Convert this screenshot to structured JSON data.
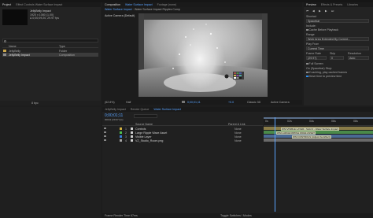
{
  "project": {
    "tabs": [
      "Project",
      "Effect Controls Water Surface Impact"
    ],
    "thumb_name": "JellyBelly Impact",
    "thumb_info": [
      "1920 x 1080 (1.00)",
      "Δ 0;00;09;20, 29.97 fps"
    ],
    "search_placeholder": "",
    "columns": [
      "Name",
      "Type"
    ],
    "items": [
      {
        "name": "JellyBelly",
        "type": "Folder",
        "color": "#e0c84e"
      },
      {
        "name": "JellyBelly Impact",
        "type": "Composition",
        "color": "#a6a6a6"
      }
    ],
    "footer": "8 bpc"
  },
  "composition": {
    "tabs": [
      "Composition",
      "Water Surface Impact",
      "Footage (none)"
    ],
    "sub_tabs": [
      "Water Surface Impact",
      "Water Surface Impact Ripples Comp"
    ],
    "camera_label": "Active Camera (Default)",
    "footer": {
      "zoom": "(62.8%)",
      "resolution": "Half",
      "timecode": "0;00;01;11",
      "exposure": "+0.0",
      "renderer": "Classic 3D",
      "view": "Active Camera",
      "views": "1 View"
    }
  },
  "preview": {
    "tabs": [
      "Preview",
      "Effects & Presets",
      "Libraries"
    ],
    "shortcut_label": "Shortcut",
    "shortcut_value": "Spacebar",
    "include_label": "Include:",
    "cache_label": "Cache Before Playback",
    "range_label": "Range",
    "range_value": "Work Area Extended By Current...",
    "play_from_label": "Play From",
    "play_from_value": "Current Time",
    "frame_rate_label": "Frame Rate",
    "skip_label": "Skip",
    "resolution_label": "Resolution",
    "frame_rate_value": "(29.97)",
    "skip_value": "0",
    "resolution_value": "Auto",
    "full_screen_label": "Full Screen",
    "on_stop_label": "On (Spacebar) Stop:",
    "if_caching_label": "If caching, play cached frames",
    "move_time_label": "Move time to preview time"
  },
  "timeline": {
    "tabs": [
      "JellyBelly Impact",
      "Render Queue",
      "Water Surface Impact"
    ],
    "timecode": "0;00;01;11",
    "fps_info": "00041 (29.97 fps)",
    "search_placeholder": "",
    "col_source": "Source Name",
    "col_parent": "Parent & Link",
    "layers": [
      {
        "num": "1",
        "name": "Controls",
        "parent": "None",
        "color": "#d4b342"
      },
      {
        "num": "2",
        "name": "Large Ripple Wave Asset",
        "parent": "None",
        "color": "#4ec24e"
      },
      {
        "num": "3",
        "name": "Visible Layer",
        "parent": "None",
        "color": "#3a7fd8"
      },
      {
        "num": "4",
        "name": "VZ_Studio_Room.png",
        "parent": "None",
        "color": "#a6a6a6"
      }
    ],
    "ruler_marks": [
      "0s",
      "02s",
      "04s",
      "06s",
      "08s"
    ],
    "track_labels": [
      "WSI VISIBLE LAYER - Solid 3 - Water Surface Impact",
      "WSI LARGE RIPPLE WAVE ASSET",
      "WSI CONTROLS (Adjust the Effect)"
    ],
    "footer": "Frame Render Time 67ms",
    "footer_toggle": "Toggle Switches / Modes"
  }
}
